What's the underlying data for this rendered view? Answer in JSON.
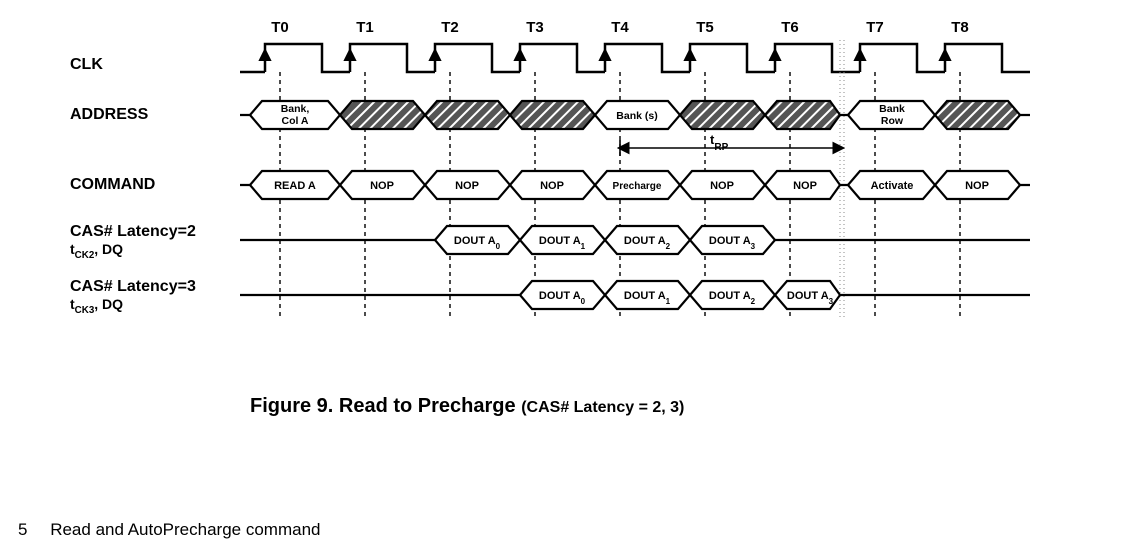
{
  "chart_data": {
    "type": "timing-diagram",
    "time_labels": [
      "T0",
      "T1",
      "T2",
      "T3",
      "T4",
      "T5",
      "T6",
      "T7",
      "T8"
    ],
    "signals": [
      {
        "name": "CLK",
        "type": "clock"
      },
      {
        "name": "ADDRESS",
        "type": "bus",
        "cells": [
          {
            "t": 0,
            "text": "Bank, Col A"
          },
          {
            "t": 1,
            "hatched": true
          },
          {
            "t": 2,
            "hatched": true
          },
          {
            "t": 3,
            "hatched": true
          },
          {
            "t": 4,
            "text": "Bank (s)"
          },
          {
            "t": 5,
            "hatched": true
          },
          {
            "t": 6,
            "hatched": true
          },
          {
            "t": 7,
            "text": "Bank Row"
          },
          {
            "t": 8,
            "hatched": true
          }
        ]
      },
      {
        "name": "COMMAND",
        "type": "bus",
        "cells": [
          {
            "t": 0,
            "text": "READ A"
          },
          {
            "t": 1,
            "text": "NOP"
          },
          {
            "t": 2,
            "text": "NOP"
          },
          {
            "t": 3,
            "text": "NOP"
          },
          {
            "t": 4,
            "text": "Precharge"
          },
          {
            "t": 5,
            "text": "NOP"
          },
          {
            "t": 6,
            "text": "NOP"
          },
          {
            "t": 7,
            "text": "Activate"
          },
          {
            "t": 8,
            "text": "NOP"
          }
        ]
      },
      {
        "name": "CAS# Latency=2",
        "sub": "tCK2, DQ",
        "type": "data",
        "base": "DOUT A",
        "start": 2,
        "burst": 4
      },
      {
        "name": "CAS# Latency=3",
        "sub": "tCK3, DQ",
        "type": "data",
        "base": "DOUT A",
        "start": 3,
        "burst": 4
      }
    ],
    "arrow": {
      "from": 4,
      "to": 7,
      "label": "tRP"
    }
  },
  "labels": {
    "clk": "CLK",
    "address": "ADDRESS",
    "command": "COMMAND",
    "cas2": "CAS# Latency=2",
    "cas2_sub_pre": "t",
    "cas2_sub_sub": "CK2",
    "cas2_sub_post": ", DQ",
    "cas3": "CAS# Latency=3",
    "cas3_sub_pre": "t",
    "cas3_sub_sub": "CK3",
    "cas3_sub_post": ", DQ",
    "trp_pre": "t",
    "trp_sub": "RP"
  },
  "address_cells": {
    "c0a": "Bank,",
    "c0b": "Col A",
    "c4": "Bank (s)",
    "c7a": "Bank",
    "c7b": "Row"
  },
  "command_cells": {
    "c0": "READ A",
    "c1": "NOP",
    "c2": "NOP",
    "c3": "NOP",
    "c4": "Precharge",
    "c5": "NOP",
    "c6": "NOP",
    "c7": "Activate",
    "c8": "NOP"
  },
  "dout_base": "DOUT A",
  "time": {
    "t0": "T0",
    "t1": "T1",
    "t2": "T2",
    "t3": "T3",
    "t4": "T4",
    "t5": "T5",
    "t6": "T6",
    "t7": "T7",
    "t8": "T8"
  },
  "caption": {
    "fig": "Figure 9. Read to Precharge ",
    "paren": "(CAS# Latency = 2, 3)"
  },
  "footer": {
    "num": "5",
    "text": "Read and AutoPrecharge command"
  }
}
